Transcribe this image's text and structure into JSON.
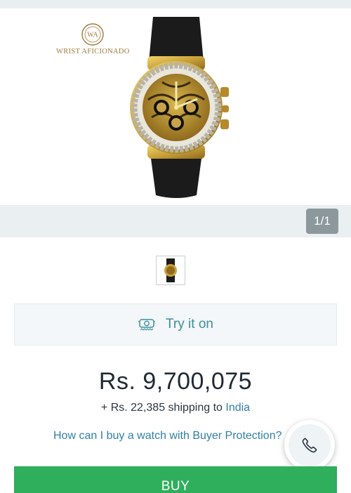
{
  "brand": {
    "name": "WRIST AFICIONADO",
    "monogram": "WA",
    "color": "#a07a3a"
  },
  "gallery": {
    "counter": "1/1",
    "icon": "watch-product-image"
  },
  "try_on": {
    "label": "Try it on",
    "icon": "watch-outline-icon"
  },
  "pricing": {
    "price": "Rs. 9,700,075",
    "shipping_prefix": "+ Rs. 22,385 shipping to ",
    "shipping_country": "India"
  },
  "links": {
    "buyer_protection": "How can I buy a watch with Buyer Protection?"
  },
  "contact": {
    "icon": "phone-icon"
  },
  "actions": {
    "buy_label": "BUY"
  },
  "colors": {
    "accent": "#3d8e9a",
    "link": "#2f7fa8",
    "buy": "#2fae5c"
  }
}
